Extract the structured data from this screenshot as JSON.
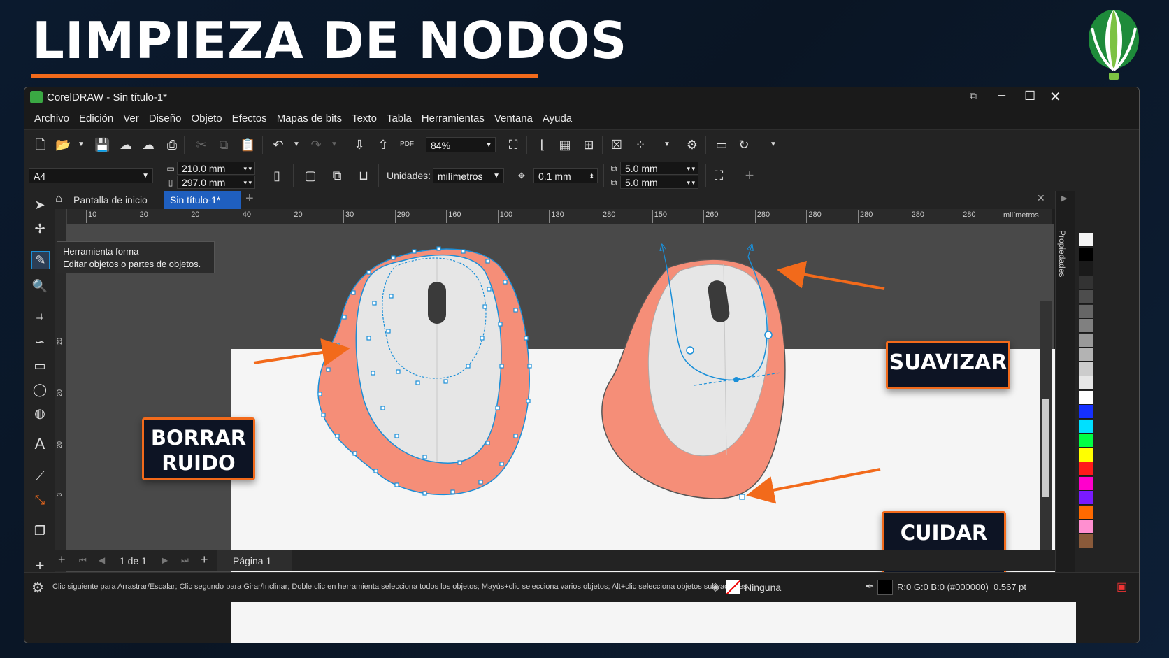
{
  "headline": "LIMPIEZA DE NODOS",
  "window": {
    "title": "CorelDRAW - Sin título-1*",
    "menu": [
      "Archivo",
      "Edición",
      "Ver",
      "Diseño",
      "Objeto",
      "Efectos",
      "Mapas de bits",
      "Texto",
      "Tabla",
      "Herramientas",
      "Ventana",
      "Ayuda"
    ]
  },
  "toolbar": {
    "zoom": "84%"
  },
  "propertybar": {
    "page_size": "A4",
    "width": "210.0 mm",
    "height": "297.0 mm",
    "units_label": "Unidades:",
    "units_value": "milímetros",
    "nudge": "0.1 mm",
    "dup_x": "5.0 mm",
    "dup_y": "5.0 mm"
  },
  "tabs": {
    "home": "Pantalla de inicio",
    "doc": "Sin título-1*"
  },
  "ruler": {
    "unit": "milímetros",
    "ticks": [
      "10",
      "20",
      "20",
      "40",
      "20",
      "30",
      "290",
      "160",
      "100",
      "130",
      "280",
      "150",
      "260",
      "280",
      "280",
      "280",
      "280",
      "280"
    ],
    "vticks": [
      "20",
      "20",
      "20",
      "3"
    ]
  },
  "tooltip": {
    "title": "Herramienta forma",
    "desc": "Editar objetos o partes de objetos."
  },
  "callouts": {
    "borrar_1": "BORRAR",
    "borrar_2": "RUIDO",
    "suavizar": "SUAVIZAR",
    "cuidar_1": "CUIDAR",
    "cuidar_2": "ESQUINAS"
  },
  "side_panel": "Propiedades",
  "pagebar": {
    "count": "1 de 1",
    "page": "Página 1"
  },
  "status": {
    "hint": "Clic siguiente para Arrastrar/Escalar; Clic segundo para Girar/Inclinar; Doble clic en herramienta selecciona todos los objetos; Mayús+clic selecciona varios objetos; Alt+clic selecciona objetos subyacentes",
    "fill": "Ninguna",
    "outline": "R:0 G:0 B:0 (#000000)  0.567 pt"
  },
  "colors": {
    "accent": "#f26a1b",
    "mouse_body": "#f58e78",
    "mouse_top": "#e6e6e6",
    "node_blue": "#1a8fd8",
    "tab_active": "#1f5fbf"
  },
  "palette": [
    "#f5f5f5",
    "#000000",
    "#1a1a1a",
    "#333333",
    "#4d4d4d",
    "#666666",
    "#808080",
    "#999999",
    "#b3b3b3",
    "#cccccc",
    "#e6e6e6",
    "#ffffff",
    "#1530ff",
    "#00e0ff",
    "#00ff44",
    "#ffff00",
    "#ff1a1a",
    "#ff00cc",
    "#7a1aff",
    "#ff6a00",
    "#ff8fd0",
    "#8a5a3a"
  ]
}
